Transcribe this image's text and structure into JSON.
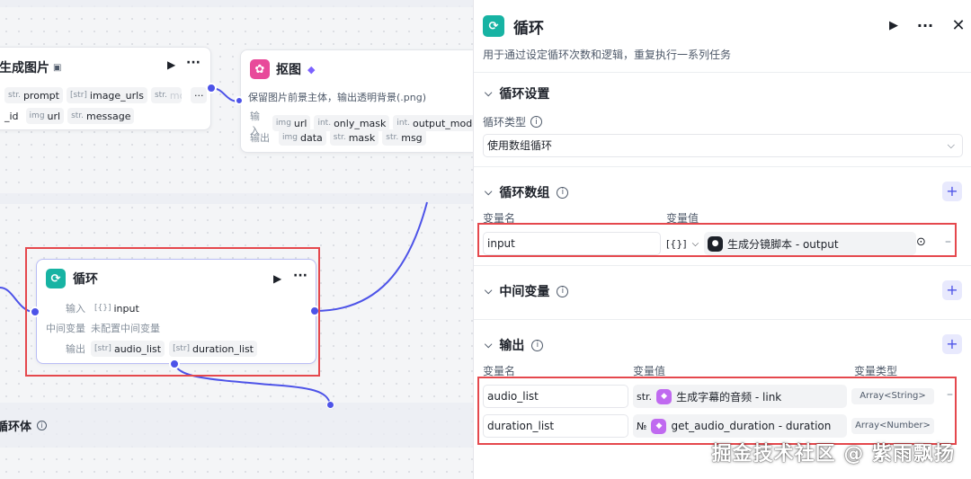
{
  "canvas": {
    "node_gen_image": {
      "title": "生成图片",
      "inputs": [
        {
          "type": "str.",
          "name": "prompt"
        },
        {
          "type": "[str]",
          "name": "image_urls"
        },
        {
          "type": "str.",
          "name": "mo"
        }
      ],
      "more": "···",
      "outputs": [
        {
          "type": "",
          "name": "_id"
        },
        {
          "type": "img",
          "name": "url"
        },
        {
          "type": "str.",
          "name": "message"
        }
      ]
    },
    "node_cutout": {
      "title": "抠图",
      "desc": "保留图片前景主体，输出透明背景(.png)",
      "input_label": "输入",
      "output_label": "输出",
      "inputs": [
        {
          "type": "img",
          "name": "url"
        },
        {
          "type": "int.",
          "name": "only_mask"
        },
        {
          "type": "int.",
          "name": "output_mode"
        }
      ],
      "outputs": [
        {
          "type": "img",
          "name": "data"
        },
        {
          "type": "str.",
          "name": "mask"
        },
        {
          "type": "str.",
          "name": "msg"
        }
      ]
    },
    "node_loop": {
      "title": "循环",
      "input_label": "输入",
      "input_value": {
        "type": "[{}]",
        "name": "input"
      },
      "middle_label": "中间变量",
      "middle_value": "未配置中间变量",
      "output_label": "输出",
      "outputs": [
        {
          "type": "[str]",
          "name": "audio_list"
        },
        {
          "type": "[str]",
          "name": "duration_list"
        }
      ]
    },
    "loop_body_label": "循环体"
  },
  "panel": {
    "title": "循环",
    "description": "用于通过设定循环次数和逻辑，重复执行一系列任务",
    "settings": {
      "title": "循环设置",
      "type_label": "循环类型",
      "type_value": "使用数组循环"
    },
    "loop_array": {
      "title": "循环数组",
      "col_name": "变量名",
      "col_value": "变量值",
      "rows": [
        {
          "name": "input",
          "type": "[{}]",
          "source": "生成分镜脚本 - output"
        }
      ]
    },
    "middle_vars": {
      "title": "中间变量"
    },
    "output": {
      "title": "输出",
      "col_name": "变量名",
      "col_value": "变量值",
      "col_type": "变量类型",
      "rows": [
        {
          "name": "audio_list",
          "type": "str.",
          "source": "生成字幕的音频 - link",
          "vtype": "Array<String>"
        },
        {
          "name": "duration_list",
          "type": "№",
          "source": "get_audio_duration - duration",
          "vtype": "Array<Number>"
        }
      ]
    }
  },
  "watermark": "掘金技术社区 @ 紫雨飘扬",
  "colors": {
    "accent": "#4d53e8",
    "loop_icon": "#17b3a3",
    "cutout_icon": "#e84a9a",
    "highlight": "#e5484d"
  }
}
